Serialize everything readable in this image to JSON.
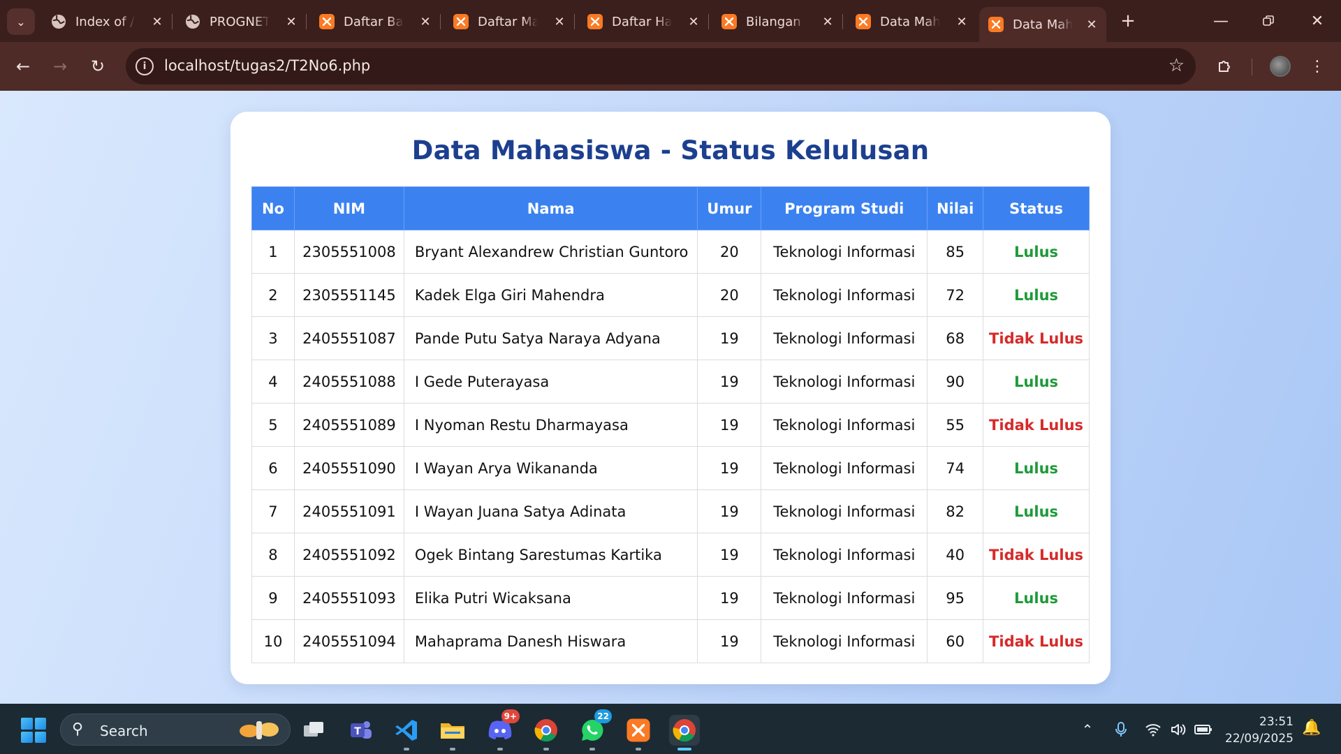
{
  "tabs": [
    {
      "title": "Index of /",
      "icon": "globe-icon"
    },
    {
      "title": "PROGNET",
      "icon": "globe-icon"
    },
    {
      "title": "Daftar Barang",
      "icon": "xampp-icon"
    },
    {
      "title": "Daftar Mahasiswa",
      "icon": "xampp-icon"
    },
    {
      "title": "Daftar Harga",
      "icon": "xampp-icon"
    },
    {
      "title": "Bilangan Genap",
      "icon": "xampp-icon"
    },
    {
      "title": "Data Mahasiswa",
      "icon": "xampp-icon"
    },
    {
      "title": "Data Mahasiswa",
      "icon": "xampp-icon",
      "active": true
    }
  ],
  "browser": {
    "url": "localhost/tugas2/T2No6.php"
  },
  "page": {
    "heading": "Data Mahasiswa - Status Kelulusan",
    "columns": [
      "No",
      "NIM",
      "Nama",
      "Umur",
      "Program Studi",
      "Nilai",
      "Status"
    ],
    "rows": [
      {
        "no": "1",
        "nim": "2305551008",
        "nama": "Bryant Alexandrew Christian Guntoro",
        "umur": "20",
        "prodi": "Teknologi Informasi",
        "nilai": "85",
        "status": "Lulus"
      },
      {
        "no": "2",
        "nim": "2305551145",
        "nama": "Kadek Elga Giri Mahendra",
        "umur": "20",
        "prodi": "Teknologi Informasi",
        "nilai": "72",
        "status": "Lulus"
      },
      {
        "no": "3",
        "nim": "2405551087",
        "nama": "Pande Putu Satya Naraya Adyana",
        "umur": "19",
        "prodi": "Teknologi Informasi",
        "nilai": "68",
        "status": "Tidak Lulus"
      },
      {
        "no": "4",
        "nim": "2405551088",
        "nama": "I Gede Puterayasa",
        "umur": "19",
        "prodi": "Teknologi Informasi",
        "nilai": "90",
        "status": "Lulus"
      },
      {
        "no": "5",
        "nim": "2405551089",
        "nama": "I Nyoman Restu Dharmayasa",
        "umur": "19",
        "prodi": "Teknologi Informasi",
        "nilai": "55",
        "status": "Tidak Lulus"
      },
      {
        "no": "6",
        "nim": "2405551090",
        "nama": "I Wayan Arya Wikananda",
        "umur": "19",
        "prodi": "Teknologi Informasi",
        "nilai": "74",
        "status": "Lulus"
      },
      {
        "no": "7",
        "nim": "2405551091",
        "nama": "I Wayan Juana Satya Adinata",
        "umur": "19",
        "prodi": "Teknologi Informasi",
        "nilai": "82",
        "status": "Lulus"
      },
      {
        "no": "8",
        "nim": "2405551092",
        "nama": "Ogek Bintang Sarestumas Kartika",
        "umur": "19",
        "prodi": "Teknologi Informasi",
        "nilai": "40",
        "status": "Tidak Lulus"
      },
      {
        "no": "9",
        "nim": "2405551093",
        "nama": "Elika Putri Wicaksana",
        "umur": "19",
        "prodi": "Teknologi Informasi",
        "nilai": "95",
        "status": "Lulus"
      },
      {
        "no": "10",
        "nim": "2405551094",
        "nama": "Mahaprama Danesh Hiswara",
        "umur": "19",
        "prodi": "Teknologi Informasi",
        "nilai": "60",
        "status": "Tidak Lulus"
      }
    ]
  },
  "taskbar": {
    "search_label": "Search",
    "apps": [
      {
        "name": "task-view"
      },
      {
        "name": "teams"
      },
      {
        "name": "vscode"
      },
      {
        "name": "file-explorer"
      },
      {
        "name": "discord",
        "badge": "9+"
      },
      {
        "name": "chrome-dev"
      },
      {
        "name": "whatsapp",
        "badge": "22"
      },
      {
        "name": "xampp"
      },
      {
        "name": "chrome",
        "active": true
      }
    ],
    "time": "23:51",
    "date": "22/09/2025"
  },
  "colors": {
    "tab_bar": "#3a1f1d",
    "toolbar": "#4e2b27",
    "heading": "#1c3f8f",
    "table_header": "#3b82f0",
    "status_pass": "#1f9a3a",
    "status_fail": "#d62a2a"
  }
}
